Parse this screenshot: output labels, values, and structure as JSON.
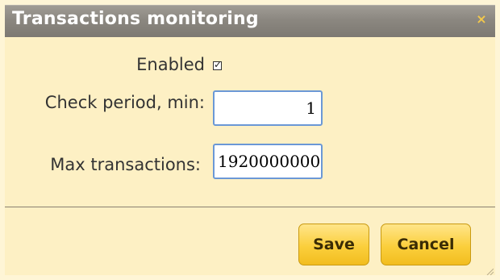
{
  "dialog": {
    "title": "Transactions monitoring",
    "close_glyph": "×"
  },
  "form": {
    "enabled": {
      "label": "Enabled",
      "checked": true,
      "check_glyph": "☑"
    },
    "check_period": {
      "label": "Check period, min:",
      "value": "1"
    },
    "max_transactions": {
      "label": "Max transactions:",
      "value": "1920000000"
    }
  },
  "buttons": {
    "save_label": "Save",
    "cancel_label": "Cancel"
  },
  "colors": {
    "title_bar": "#8b8780",
    "content_background": "#fdf0c4",
    "button_accent": "#fbcf3c",
    "input_border": "#6b98d6"
  }
}
